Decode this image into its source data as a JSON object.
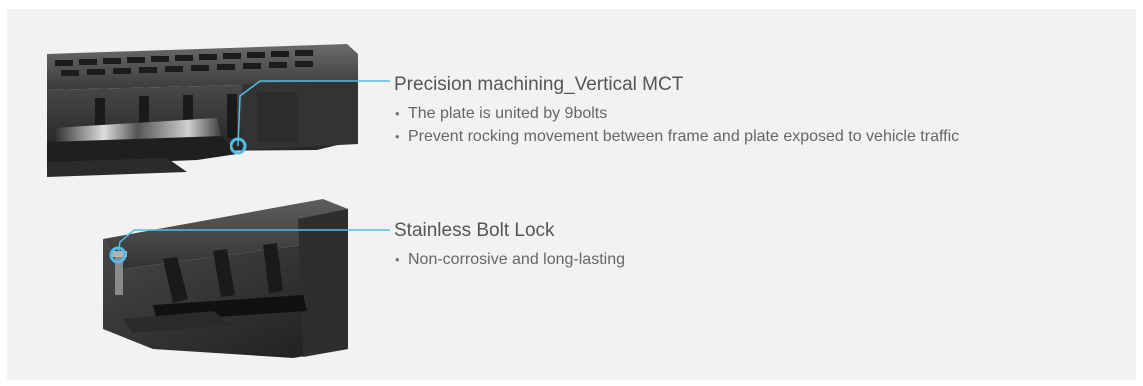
{
  "accent_color": "#52bde8",
  "features": [
    {
      "title": "Precision machining_Vertical MCT",
      "bullets": [
        "The plate is united by 9bolts",
        "Prevent rocking movement between frame and plate exposed to vehicle traffic"
      ],
      "image_icon": "drainage-grating-icon"
    },
    {
      "title": "Stainless Bolt Lock",
      "bullets": [
        "Non-corrosive and long-lasting"
      ],
      "image_icon": "bolt-lock-icon"
    }
  ]
}
